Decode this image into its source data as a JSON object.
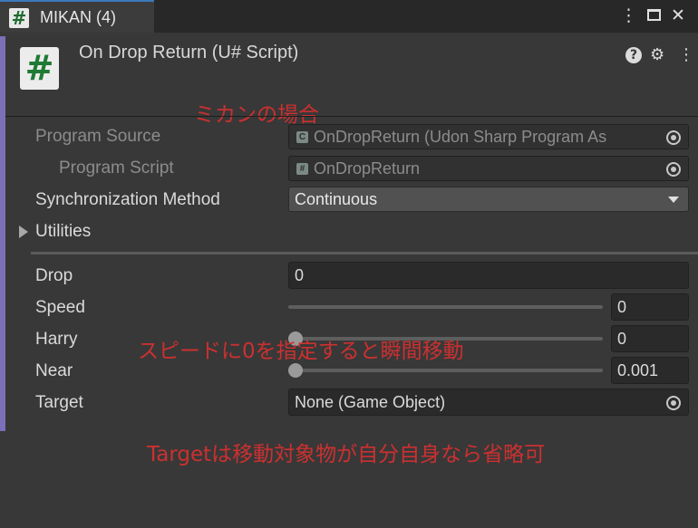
{
  "tab": {
    "icon": "#",
    "label": "MIKAN (4)"
  },
  "window_controls": {
    "more": "⋮",
    "close": "✕"
  },
  "component": {
    "icon": "#",
    "title": "On Drop Return (U# Script)",
    "help": "?",
    "presets": "⚙",
    "more": "⋮"
  },
  "annotations": {
    "mikan": "ミカンの場合",
    "speed_note": "スピードに0を指定すると瞬間移動",
    "target_note": "Targetは移動対象物が自分自身なら省略可"
  },
  "fields": {
    "program_source": {
      "label": "Program Source",
      "value": "OnDropReturn (Udon Sharp Program As"
    },
    "program_script": {
      "label": "Program Script",
      "value": "OnDropReturn"
    },
    "sync_method": {
      "label": "Synchronization Method",
      "value": "Continuous"
    },
    "utilities": {
      "label": "Utilities"
    },
    "drop": {
      "label": "Drop",
      "value": "0"
    },
    "speed": {
      "label": "Speed",
      "value": "0",
      "slider": 0
    },
    "harry": {
      "label": "Harry",
      "value": "0",
      "slider": 0
    },
    "near": {
      "label": "Near",
      "value": "0.001",
      "slider": 0.001
    },
    "target": {
      "label": "Target",
      "value": "None (Game Object)"
    }
  },
  "colors": {
    "accent_bar": "#7d6fb8",
    "annotation": "#cc3030",
    "tab_highlight": "#3a79bb"
  }
}
